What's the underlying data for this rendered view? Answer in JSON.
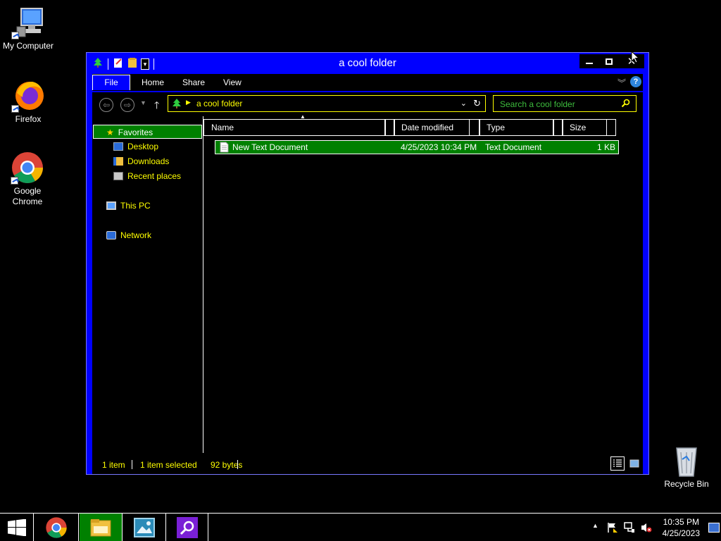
{
  "desktop": {
    "icons": [
      {
        "label": "My Computer"
      },
      {
        "label": "Firefox"
      },
      {
        "label": "Google Chrome"
      },
      {
        "label": "Recycle Bin"
      }
    ]
  },
  "window": {
    "title": "a cool folder",
    "ribbon_tabs": [
      "File",
      "Home",
      "Share",
      "View"
    ],
    "address": "a cool folder",
    "search_placeholder": "Search a cool folder",
    "nav_items": [
      {
        "label": "Favorites",
        "selected": true
      },
      {
        "label": "Desktop"
      },
      {
        "label": "Downloads"
      },
      {
        "label": "Recent places"
      },
      {
        "label": "This PC"
      },
      {
        "label": "Network"
      }
    ],
    "columns": [
      "Name",
      "Date modified",
      "Type",
      "Size"
    ],
    "files": [
      {
        "name": "New Text Document",
        "date": "4/25/2023 10:34 PM",
        "type": "Text Document",
        "size": "1 KB"
      }
    ],
    "status": {
      "count": "1 item",
      "selected": "1 item selected",
      "bytes": "92 bytes"
    }
  },
  "taskbar": {
    "time": "10:35 PM",
    "date": "4/25/2023"
  },
  "colors": {
    "window_bg": "#0000ff",
    "selection": "#008000",
    "text_accent": "#ffff00",
    "search_placeholder": "#3dbd3d"
  }
}
